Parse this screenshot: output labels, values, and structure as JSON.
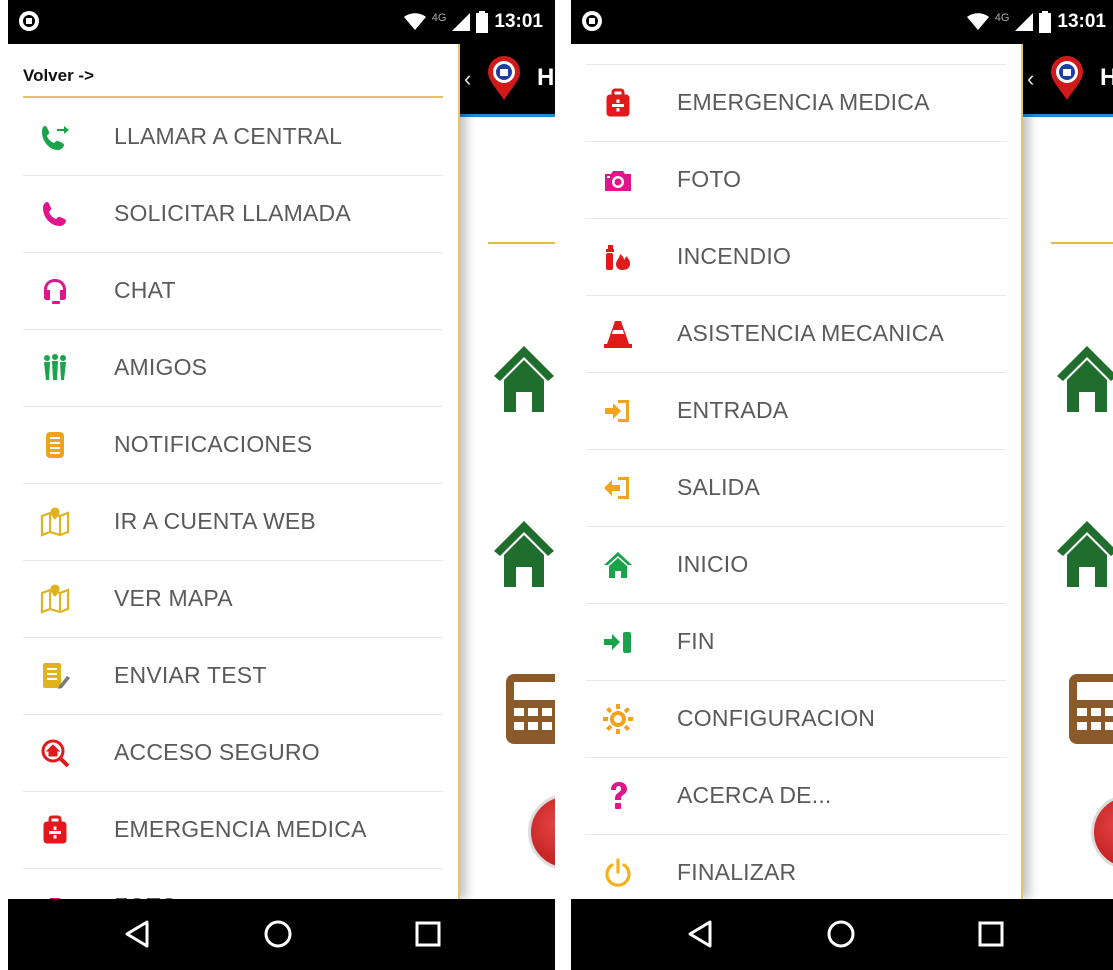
{
  "status_bar": {
    "time": "13:01",
    "network": "4G"
  },
  "app": {
    "header_text": "H"
  },
  "left": {
    "drawer_title": "Volver ->",
    "items": [
      {
        "label": "LLAMAR A CENTRAL",
        "icon": "phone-transfer-icon",
        "color": "#1aa34a"
      },
      {
        "label": "SOLICITAR LLAMADA",
        "icon": "phone-call-icon",
        "color": "#e0158c"
      },
      {
        "label": "CHAT",
        "icon": "headset-icon",
        "color": "#e0158c"
      },
      {
        "label": "AMIGOS",
        "icon": "people-icon",
        "color": "#1aa34a"
      },
      {
        "label": "NOTIFICACIONES",
        "icon": "notification-icon",
        "color": "#f2a31b"
      },
      {
        "label": "IR A CUENTA WEB",
        "icon": "map-pin-icon",
        "color": "#e0b21e"
      },
      {
        "label": "VER MAPA",
        "icon": "map-icon",
        "color": "#e0b21e"
      },
      {
        "label": "ENVIAR TEST",
        "icon": "checklist-icon",
        "color": "#e0b21e"
      },
      {
        "label": "ACCESO SEGURO",
        "icon": "secure-search-icon",
        "color": "#e01a1a"
      },
      {
        "label": "EMERGENCIA MEDICA",
        "icon": "medical-kit-icon",
        "color": "#e01a1a"
      },
      {
        "label": "FOTO",
        "icon": "camera-icon",
        "color": "#e0158c"
      }
    ]
  },
  "right": {
    "items": [
      {
        "label": "EMERGENCIA MEDICA",
        "icon": "medical-kit-icon",
        "color": "#e01a1a"
      },
      {
        "label": "FOTO",
        "icon": "camera-icon",
        "color": "#e0158c"
      },
      {
        "label": "INCENDIO",
        "icon": "fire-extinguisher-icon",
        "color": "#e01a1a"
      },
      {
        "label": "ASISTENCIA MECANICA",
        "icon": "traffic-cone-icon",
        "color": "#e01a1a"
      },
      {
        "label": "ENTRADA",
        "icon": "enter-icon",
        "color": "#f2a31b"
      },
      {
        "label": "SALIDA",
        "icon": "exit-icon",
        "color": "#f2a31b"
      },
      {
        "label": "INICIO",
        "icon": "home-icon",
        "color": "#1aa34a"
      },
      {
        "label": "FIN",
        "icon": "finish-icon",
        "color": "#1aa34a"
      },
      {
        "label": "CONFIGURACION",
        "icon": "gear-icon",
        "color": "#f2a31b"
      },
      {
        "label": "ACERCA DE...",
        "icon": "question-icon",
        "color": "#e0158c"
      },
      {
        "label": "FINALIZAR",
        "icon": "power-icon",
        "color": "#f2b21b"
      }
    ]
  }
}
